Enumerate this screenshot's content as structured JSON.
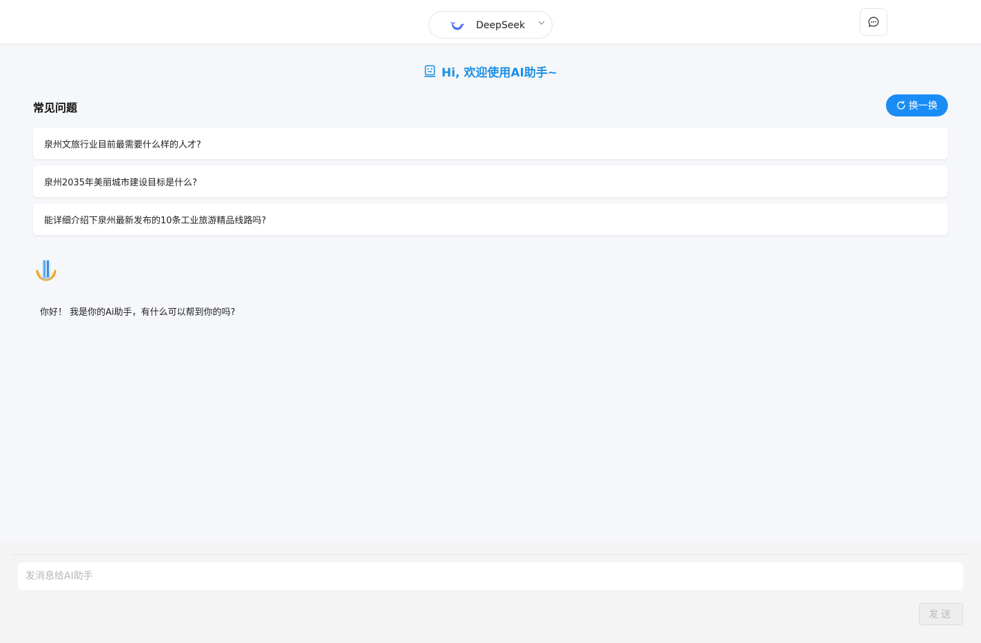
{
  "header": {
    "model_name": "DeepSeek",
    "model_icon": "deepseek-whale-icon",
    "chat_icon": "chat-bubble-icon"
  },
  "welcome": {
    "text": "Hi, 欢迎使用AI助手~",
    "icon": "robot-icon"
  },
  "faq": {
    "title": "常见问题",
    "refresh_label": "换一换",
    "items": [
      "泉州文旅行业目前最需要什么样的人才?",
      "泉州2035年美丽城市建设目标是什么?",
      "能详细介绍下泉州最新发布的10条工业旅游精品线路吗?"
    ]
  },
  "conversation": {
    "bot_message": "你好！ 我是你的Ai助手，有什么可以帮到你的吗?"
  },
  "composer": {
    "placeholder": "发消息给AI助手",
    "send_label": "发送"
  },
  "colors": {
    "accent": "#1a8cf5",
    "welcome_text": "#1a8fe6"
  }
}
